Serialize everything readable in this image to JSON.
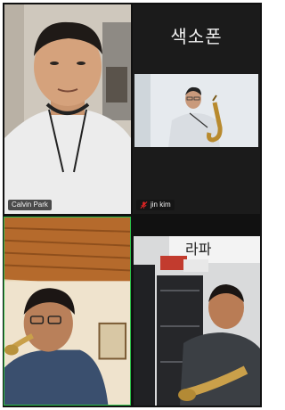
{
  "participants": [
    {
      "name": "Calvin Park",
      "muted": false,
      "active_speaker": false
    },
    {
      "name": "jin kim",
      "muted": true,
      "active_speaker": false,
      "tile_heading": "색소폰"
    },
    {
      "name": "",
      "muted": false,
      "active_speaker": true
    },
    {
      "name": "",
      "muted": false,
      "active_speaker": false
    }
  ],
  "colors": {
    "active_speaker_border": "#2ec24a",
    "muted_icon": "#e02424",
    "grid_background": "#111111"
  },
  "icons": {
    "muted": "mic-off-icon"
  }
}
